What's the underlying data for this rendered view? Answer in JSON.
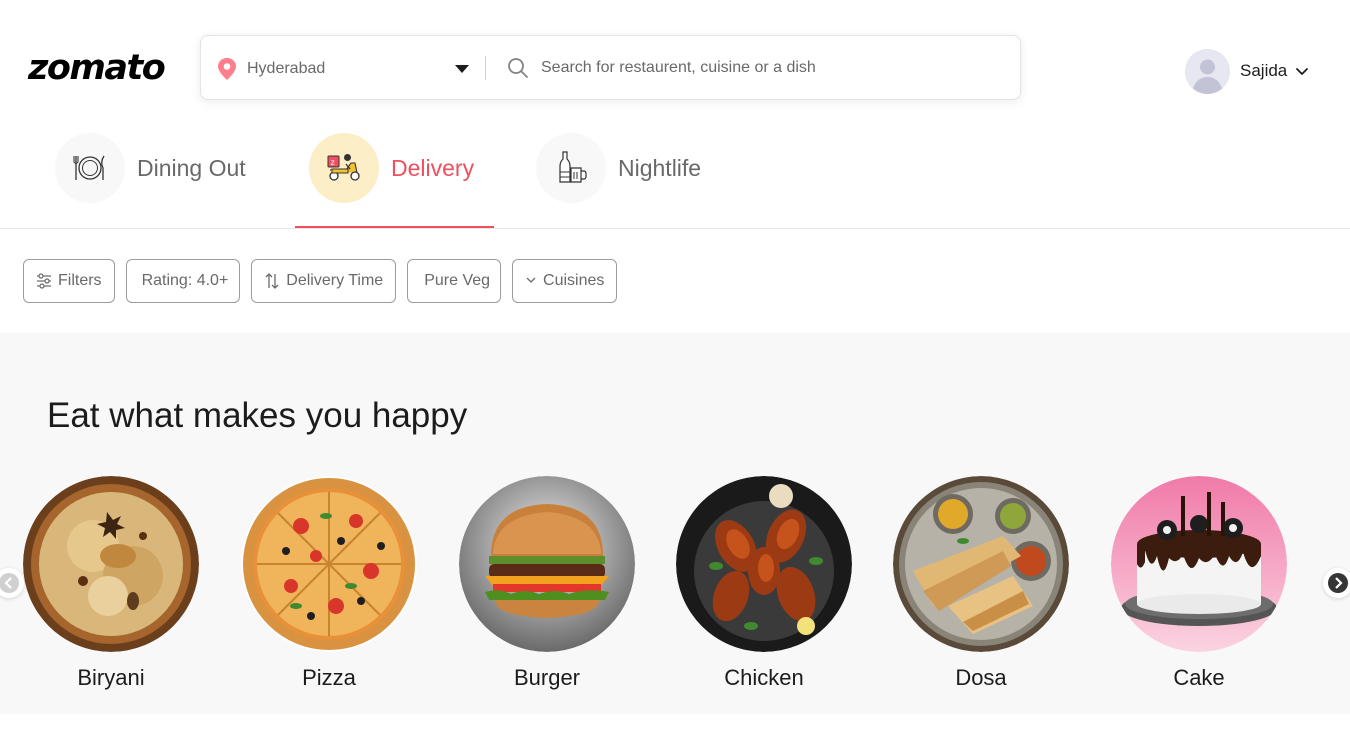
{
  "brand": {
    "logo_text": "zomato",
    "accent": "#ef4f5f"
  },
  "search": {
    "location": "Hyderabad",
    "placeholder": "Search for restaurent, cuisine or a dish",
    "value": ""
  },
  "user": {
    "name": "Sajida"
  },
  "tabs": [
    {
      "label": "Dining Out",
      "icon": "dining-icon",
      "active": false
    },
    {
      "label": "Delivery",
      "icon": "delivery-scooter-icon",
      "active": true
    },
    {
      "label": "Nightlife",
      "icon": "nightlife-bottle-icon",
      "active": false
    }
  ],
  "filters": [
    {
      "label": "Filters",
      "icon": "sliders-icon"
    },
    {
      "label": "Rating: 4.0+"
    },
    {
      "label": "Delivery Time",
      "icon": "sort-arrows-icon"
    },
    {
      "label": "Pure Veg"
    },
    {
      "label": "Cuisines",
      "icon": "chevron-down-icon"
    }
  ],
  "section": {
    "title": "Eat what makes you happy"
  },
  "dishes": [
    {
      "label": "Biryani"
    },
    {
      "label": "Pizza"
    },
    {
      "label": "Burger"
    },
    {
      "label": "Chicken"
    },
    {
      "label": "Dosa"
    },
    {
      "label": "Cake"
    }
  ]
}
